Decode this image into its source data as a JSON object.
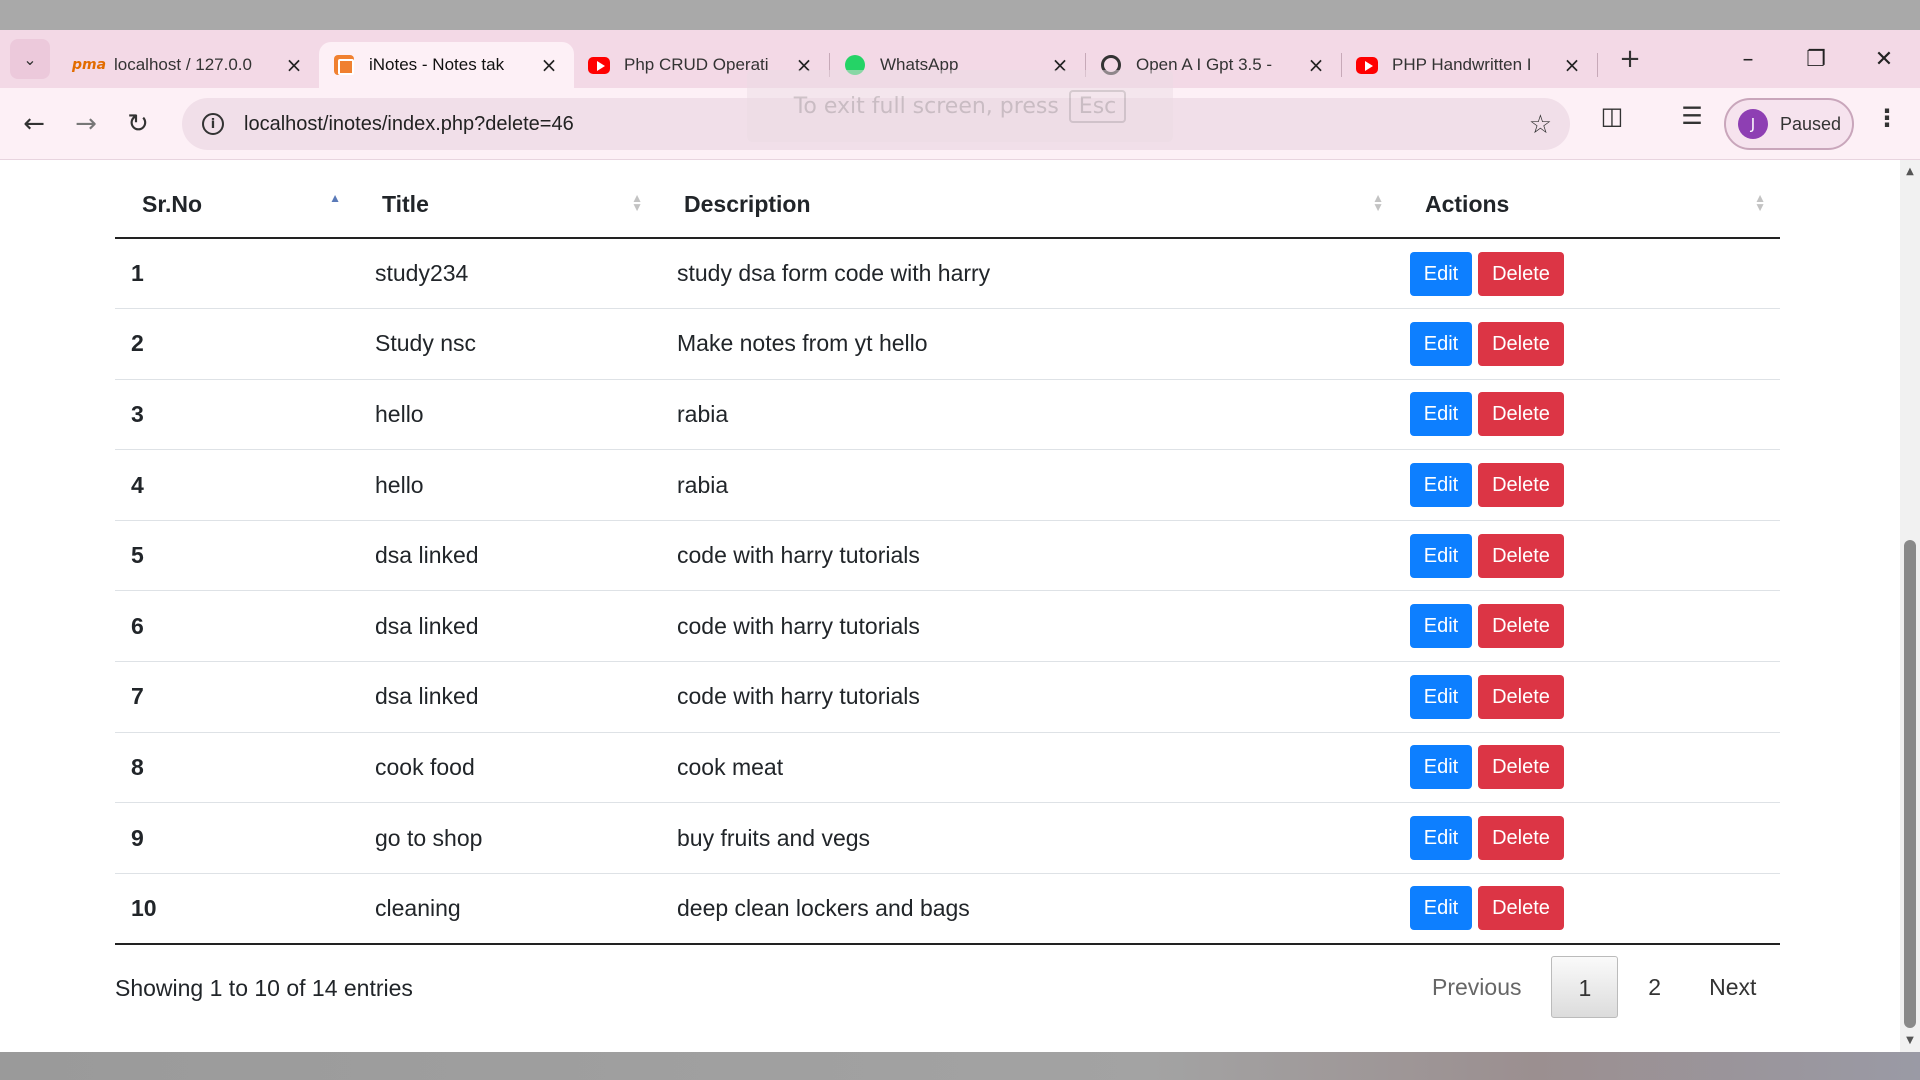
{
  "browser": {
    "tabs": [
      {
        "label": "localhost / 127.0.0",
        "icon": "phpmyadmin-icon"
      },
      {
        "label": "iNotes - Notes tak",
        "icon": "inotes-icon"
      },
      {
        "label": "Php CRUD Operati",
        "icon": "youtube-icon"
      },
      {
        "label": "WhatsApp",
        "icon": "whatsapp-icon"
      },
      {
        "label": "Open A I Gpt 3.5 -",
        "icon": "openai-icon"
      },
      {
        "label": "PHP Handwritten I",
        "icon": "youtube-icon"
      }
    ],
    "active_tab": 1,
    "url": "localhost/inotes/index.php?delete=46",
    "profile_initial": "J",
    "profile_status": "Paused",
    "toast_text": "To exit full screen, press",
    "toast_key": "Esc"
  },
  "table": {
    "headers": [
      "Sr.No",
      "Title",
      "Description",
      "Actions"
    ],
    "sorted_column": "Sr.No",
    "edit_label": "Edit",
    "delete_label": "Delete",
    "rows": [
      {
        "sr": "1",
        "title": "study234",
        "description": "study dsa form code with harry"
      },
      {
        "sr": "2",
        "title": "Study nsc",
        "description": "Make notes from yt hello"
      },
      {
        "sr": "3",
        "title": "hello",
        "description": "rabia"
      },
      {
        "sr": "4",
        "title": "hello",
        "description": "rabia"
      },
      {
        "sr": "5",
        "title": "dsa linked",
        "description": "code with harry tutorials"
      },
      {
        "sr": "6",
        "title": "dsa linked",
        "description": "code with harry tutorials"
      },
      {
        "sr": "7",
        "title": "dsa linked",
        "description": "code with harry tutorials"
      },
      {
        "sr": "8",
        "title": "cook food",
        "description": "cook meat"
      },
      {
        "sr": "9",
        "title": "go to shop",
        "description": "buy fruits and vegs"
      },
      {
        "sr": "10",
        "title": "cleaning",
        "description": "deep clean lockers and bags"
      }
    ]
  },
  "footer": {
    "info": "Showing 1 to 10 of 14 entries",
    "previous": "Previous",
    "pages": [
      "1",
      "2"
    ],
    "current_page": "1",
    "next": "Next"
  },
  "colors": {
    "edit": "#0d7fff",
    "delete": "#dc3545",
    "tabbar": "#f3d9e6"
  }
}
